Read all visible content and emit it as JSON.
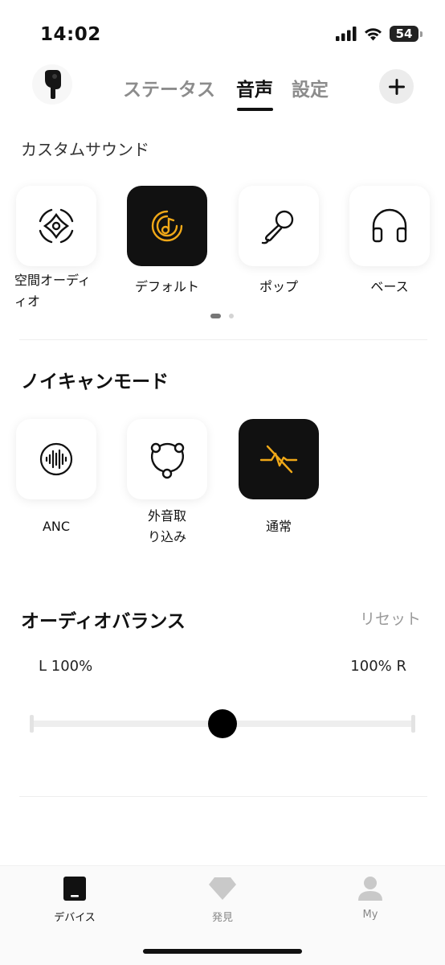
{
  "status_bar": {
    "time": "14:02",
    "battery": "54"
  },
  "header": {
    "tabs": [
      {
        "label": "ステータス",
        "active": false
      },
      {
        "label": "音声",
        "active": true
      },
      {
        "label": "設定",
        "active": false
      }
    ],
    "add_icon": "plus-icon",
    "device_icon": "earbud-icon"
  },
  "custom_sound": {
    "title": "カスタムサウンド",
    "presets": [
      {
        "label_lines": [
          "空間オーディ",
          "ィオ"
        ],
        "icon": "spatial-audio-icon",
        "selected": false
      },
      {
        "label_lines": [
          "デフォルト"
        ],
        "icon": "music-disc-icon",
        "selected": true
      },
      {
        "label_lines": [
          "ポップ"
        ],
        "icon": "microphone-icon",
        "selected": false
      },
      {
        "label_lines": [
          "ベース"
        ],
        "icon": "headphones-icon",
        "selected": false
      }
    ],
    "page_count": 2,
    "current_page": 1
  },
  "anc_mode": {
    "title": "ノイキャンモード",
    "modes": [
      {
        "label_lines": [
          "ANC"
        ],
        "icon": "soundwave-icon",
        "selected": false
      },
      {
        "label_lines": [
          "外音取",
          "り込み"
        ],
        "icon": "transparency-icon",
        "selected": false
      },
      {
        "label_lines": [
          "通常"
        ],
        "icon": "normal-mode-icon",
        "selected": true
      }
    ]
  },
  "audio_balance": {
    "title": "オーディオバランス",
    "reset_label": "リセット",
    "left_label": "L 100%",
    "right_label": "100% R",
    "value": 0.5
  },
  "bottom_nav": {
    "items": [
      {
        "label": "デバイス",
        "icon": "device-icon",
        "active": true
      },
      {
        "label": "発見",
        "icon": "diamond-icon",
        "active": false
      },
      {
        "label": "My",
        "icon": "person-icon",
        "active": false
      }
    ]
  },
  "colors": {
    "accent": "#f0a818",
    "selected_tile": "#111111",
    "text": "#111111",
    "muted": "#8c8c8c"
  }
}
